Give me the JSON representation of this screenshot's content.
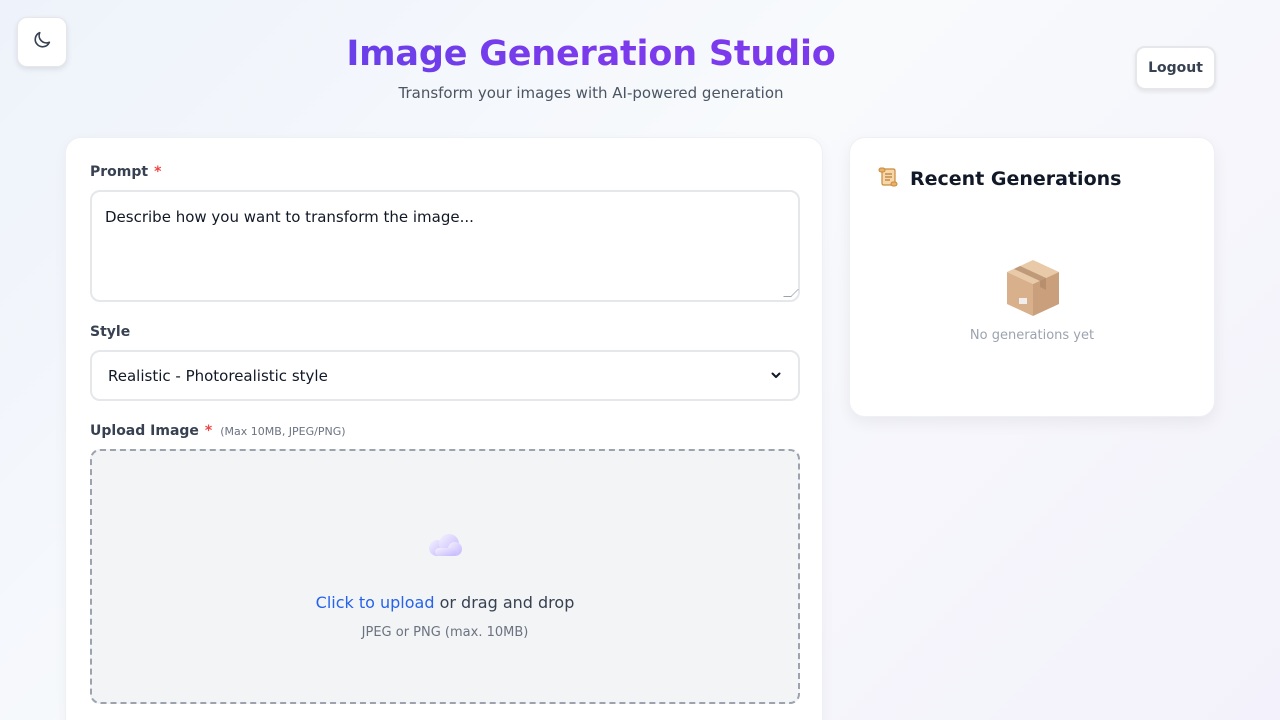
{
  "theme_toggle": {
    "icon": "moon-icon"
  },
  "header": {
    "title": "Image Generation Studio",
    "subtitle": "Transform your images with AI-powered generation"
  },
  "logout_label": "Logout",
  "form": {
    "prompt": {
      "label": "Prompt",
      "required_mark": "*",
      "placeholder": "Describe how you want to transform the image..."
    },
    "style": {
      "label": "Style",
      "selected": "Realistic - Photorealistic style"
    },
    "upload": {
      "label": "Upload Image",
      "required_mark": "*",
      "hint": "(Max 10MB, JPEG/PNG)",
      "icon": "cloud-upload-icon",
      "link_text": "Click to upload",
      "rest_text": "or drag and drop",
      "subtext": "JPEG or PNG (max. 10MB)"
    }
  },
  "recent": {
    "icon": "scroll-icon",
    "title": "Recent Generations",
    "empty_icon": "package-box-icon",
    "empty_text": "No generations yet"
  },
  "colors": {
    "accent_start": "#4f46e5",
    "accent_end": "#7c3aed",
    "link": "#2563eb",
    "required": "#ef4444"
  }
}
